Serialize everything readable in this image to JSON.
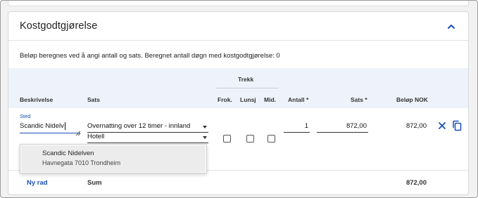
{
  "section": {
    "title": "Kostgodtgjørelse",
    "info": "Beløp beregnes ved å angi antall og sats.  Beregnet antall døgn med kostgodtgjørelse: 0"
  },
  "table": {
    "group_header": "Trekk",
    "columns": {
      "beskrivelse": "Beskrivelse",
      "sats": "Sats",
      "frok": "Frok.",
      "lunsj": "Lunsj",
      "mid": "Mid.",
      "antall": "Antall *",
      "sats_value": "Sats *",
      "belop": "Beløp NOK"
    },
    "row": {
      "sted_label": "Sted",
      "sted_value": "Scandic Nidelv",
      "sats_select": "Overnatting over 12 timer - innland",
      "overnatting_select": "Hotell",
      "frok_checked": false,
      "lunsj_checked": false,
      "mid_checked": false,
      "antall": "1",
      "sats": "872,00",
      "belop": "872,00"
    },
    "suggestions": [
      {
        "name": "Scandic Nidelven",
        "address": "Havnegata 7010 Trondheim"
      }
    ]
  },
  "footer": {
    "new_row": "Ny rad",
    "sum_label": "Sum",
    "sum_value": "872,00"
  },
  "colors": {
    "accent": "#1b4fb5",
    "header_bg": "#eef3fb"
  },
  "icons": [
    "chevron-up-icon",
    "close-icon",
    "copy-icon",
    "resize-grip-icon",
    "caret-down-icon"
  ]
}
